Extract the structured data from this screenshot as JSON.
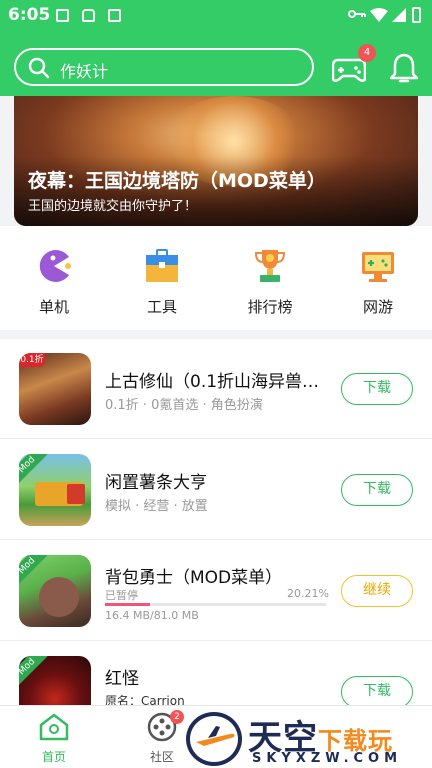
{
  "status_bar": {
    "time": "6:05"
  },
  "header": {
    "search_placeholder": "作妖计",
    "gamepad_badge": "4"
  },
  "banner": {
    "title": "夜幕：王国边境塔防（MOD菜单）",
    "subtitle": "王国的边境就交由你守护了！"
  },
  "categories": [
    {
      "label": "单机",
      "icon": "pacman-icon"
    },
    {
      "label": "工具",
      "icon": "toolbox-icon"
    },
    {
      "label": "排行榜",
      "icon": "trophy-icon"
    },
    {
      "label": "网游",
      "icon": "monitor-gamepad-icon"
    }
  ],
  "apps": [
    {
      "name": "上古修仙（0.1折山海异兽…",
      "meta": "0.1折 · 0氪首选 · 角色扮演",
      "button": "下载",
      "thumb_badge": "0.1折"
    },
    {
      "name": "闲置薯条大亨",
      "meta": "模拟 · 经营 · 放置",
      "button": "下载",
      "thumb_badge": "Mod"
    },
    {
      "name": "背包勇士（MOD菜单）",
      "status": "已暂停",
      "percent": "20.21%",
      "progress": 0.2021,
      "size": "16.4 MB/81.0 MB",
      "button": "继续",
      "thumb_badge": "Mod"
    },
    {
      "name": "红怪",
      "original": "原名：Carrion",
      "button": "下载",
      "thumb_badge": "Mod"
    }
  ],
  "bottom_nav": {
    "home": "首页",
    "community": "社区",
    "community_badge": "2"
  },
  "watermark": {
    "brand_main": "天空",
    "brand_sub": "下载玩",
    "url": "SKYXZW.COM"
  },
  "colors": {
    "primary": "#33cc66",
    "button_green": "#33bb5e",
    "continue_yellow": "#f5c12e",
    "progress": "#f0557a",
    "badge": "#f05454"
  }
}
